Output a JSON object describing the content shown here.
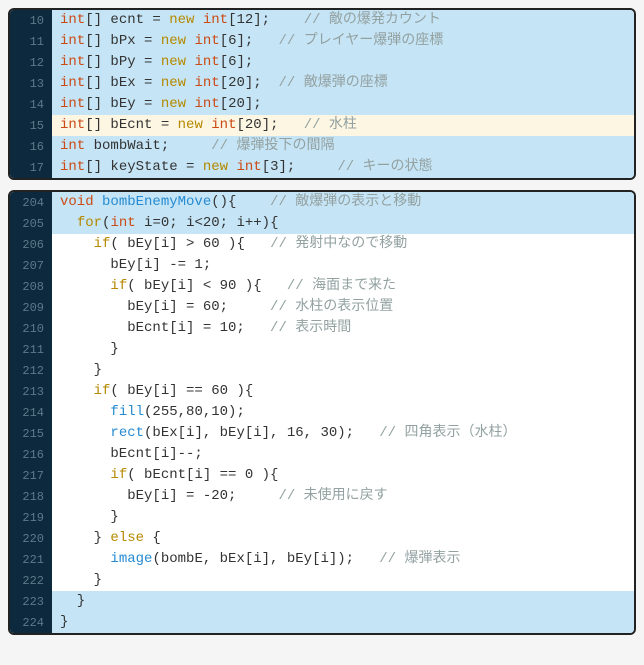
{
  "block1": {
    "lines": [
      {
        "num": "10",
        "hl": "hl-blue",
        "tokens": [
          {
            "t": "int",
            "c": "orange"
          },
          {
            "t": "[] ecnt = ",
            "c": "ident"
          },
          {
            "t": "new",
            "c": "brown"
          },
          {
            "t": " ",
            "c": "ident"
          },
          {
            "t": "int",
            "c": "orange"
          },
          {
            "t": "[12];    ",
            "c": "ident"
          },
          {
            "t": "// 敵の爆発カウント",
            "c": "cmt"
          }
        ]
      },
      {
        "num": "11",
        "hl": "hl-blue",
        "tokens": [
          {
            "t": "int",
            "c": "orange"
          },
          {
            "t": "[] bPx = ",
            "c": "ident"
          },
          {
            "t": "new",
            "c": "brown"
          },
          {
            "t": " ",
            "c": "ident"
          },
          {
            "t": "int",
            "c": "orange"
          },
          {
            "t": "[6];   ",
            "c": "ident"
          },
          {
            "t": "// プレイヤー爆弾の座標",
            "c": "cmt"
          }
        ]
      },
      {
        "num": "12",
        "hl": "hl-blue",
        "tokens": [
          {
            "t": "int",
            "c": "orange"
          },
          {
            "t": "[] bPy = ",
            "c": "ident"
          },
          {
            "t": "new",
            "c": "brown"
          },
          {
            "t": " ",
            "c": "ident"
          },
          {
            "t": "int",
            "c": "orange"
          },
          {
            "t": "[6];",
            "c": "ident"
          }
        ]
      },
      {
        "num": "13",
        "hl": "hl-blue",
        "tokens": [
          {
            "t": "int",
            "c": "orange"
          },
          {
            "t": "[] bEx = ",
            "c": "ident"
          },
          {
            "t": "new",
            "c": "brown"
          },
          {
            "t": " ",
            "c": "ident"
          },
          {
            "t": "int",
            "c": "orange"
          },
          {
            "t": "[20];  ",
            "c": "ident"
          },
          {
            "t": "// 敵爆弾の座標",
            "c": "cmt"
          }
        ]
      },
      {
        "num": "14",
        "hl": "hl-blue",
        "tokens": [
          {
            "t": "int",
            "c": "orange"
          },
          {
            "t": "[] bEy = ",
            "c": "ident"
          },
          {
            "t": "new",
            "c": "brown"
          },
          {
            "t": " ",
            "c": "ident"
          },
          {
            "t": "int",
            "c": "orange"
          },
          {
            "t": "[20];",
            "c": "ident"
          }
        ]
      },
      {
        "num": "15",
        "hl": "hl-beige",
        "tokens": [
          {
            "t": "int",
            "c": "orange"
          },
          {
            "t": "[] bEcnt = ",
            "c": "ident"
          },
          {
            "t": "new",
            "c": "brown"
          },
          {
            "t": " ",
            "c": "ident"
          },
          {
            "t": "int",
            "c": "orange"
          },
          {
            "t": "[20];   ",
            "c": "ident"
          },
          {
            "t": "// 水柱",
            "c": "cmt"
          }
        ]
      },
      {
        "num": "16",
        "hl": "hl-blue",
        "tokens": [
          {
            "t": "int",
            "c": "orange"
          },
          {
            "t": " bombWait;     ",
            "c": "ident"
          },
          {
            "t": "// 爆弾投下の間隔",
            "c": "cmt"
          }
        ]
      },
      {
        "num": "17",
        "hl": "hl-blue",
        "tokens": [
          {
            "t": "int",
            "c": "orange"
          },
          {
            "t": "[] keyState = ",
            "c": "ident"
          },
          {
            "t": "new",
            "c": "brown"
          },
          {
            "t": " ",
            "c": "ident"
          },
          {
            "t": "int",
            "c": "orange"
          },
          {
            "t": "[3];     ",
            "c": "ident"
          },
          {
            "t": "// キーの状態",
            "c": "cmt"
          }
        ]
      }
    ]
  },
  "block2": {
    "lines": [
      {
        "num": "204",
        "hl": "hl-blue",
        "tokens": [
          {
            "t": "void",
            "c": "orange"
          },
          {
            "t": " ",
            "c": "ident"
          },
          {
            "t": "bombEnemyMove",
            "c": "kw"
          },
          {
            "t": "(){    ",
            "c": "ident"
          },
          {
            "t": "// 敵爆弾の表示と移動",
            "c": "cmt"
          }
        ]
      },
      {
        "num": "205",
        "hl": "hl-blue",
        "tokens": [
          {
            "t": "  ",
            "c": "ident"
          },
          {
            "t": "for",
            "c": "brown"
          },
          {
            "t": "(",
            "c": "ident"
          },
          {
            "t": "int",
            "c": "orange"
          },
          {
            "t": " i=0; i<20; i++){",
            "c": "ident"
          }
        ]
      },
      {
        "num": "206",
        "hl": "hl-white",
        "tokens": [
          {
            "t": "    ",
            "c": "ident"
          },
          {
            "t": "if",
            "c": "brown"
          },
          {
            "t": "( bEy[i] > 60 ){   ",
            "c": "ident"
          },
          {
            "t": "// 発射中なので移動",
            "c": "cmt"
          }
        ]
      },
      {
        "num": "207",
        "hl": "hl-white",
        "tokens": [
          {
            "t": "      bEy[i] -= 1;",
            "c": "ident"
          }
        ]
      },
      {
        "num": "208",
        "hl": "hl-white",
        "tokens": [
          {
            "t": "      ",
            "c": "ident"
          },
          {
            "t": "if",
            "c": "brown"
          },
          {
            "t": "( bEy[i] < 90 ){   ",
            "c": "ident"
          },
          {
            "t": "// 海面まで来た",
            "c": "cmt"
          }
        ]
      },
      {
        "num": "209",
        "hl": "hl-white",
        "tokens": [
          {
            "t": "        bEy[i] = 60;     ",
            "c": "ident"
          },
          {
            "t": "// 水柱の表示位置",
            "c": "cmt"
          }
        ]
      },
      {
        "num": "210",
        "hl": "hl-white",
        "tokens": [
          {
            "t": "        bEcnt[i] = 10;   ",
            "c": "ident"
          },
          {
            "t": "// 表示時間",
            "c": "cmt"
          }
        ]
      },
      {
        "num": "211",
        "hl": "hl-white",
        "tokens": [
          {
            "t": "      }",
            "c": "ident"
          }
        ]
      },
      {
        "num": "212",
        "hl": "hl-white",
        "tokens": [
          {
            "t": "    }",
            "c": "ident"
          }
        ]
      },
      {
        "num": "213",
        "hl": "hl-white",
        "tokens": [
          {
            "t": "    ",
            "c": "ident"
          },
          {
            "t": "if",
            "c": "brown"
          },
          {
            "t": "( bEy[i] == 60 ){",
            "c": "ident"
          }
        ]
      },
      {
        "num": "214",
        "hl": "hl-white",
        "tokens": [
          {
            "t": "      ",
            "c": "ident"
          },
          {
            "t": "fill",
            "c": "kw"
          },
          {
            "t": "(255,80,10);",
            "c": "ident"
          }
        ]
      },
      {
        "num": "215",
        "hl": "hl-white",
        "tokens": [
          {
            "t": "      ",
            "c": "ident"
          },
          {
            "t": "rect",
            "c": "kw"
          },
          {
            "t": "(bEx[i], bEy[i], 16, 30);   ",
            "c": "ident"
          },
          {
            "t": "// 四角表示（水柱）",
            "c": "cmt"
          }
        ]
      },
      {
        "num": "216",
        "hl": "hl-white",
        "tokens": [
          {
            "t": "      bEcnt[i]--;",
            "c": "ident"
          }
        ]
      },
      {
        "num": "217",
        "hl": "hl-white",
        "tokens": [
          {
            "t": "      ",
            "c": "ident"
          },
          {
            "t": "if",
            "c": "brown"
          },
          {
            "t": "( bEcnt[i] == 0 ){",
            "c": "ident"
          }
        ]
      },
      {
        "num": "218",
        "hl": "hl-white",
        "tokens": [
          {
            "t": "        bEy[i] = -20;     ",
            "c": "ident"
          },
          {
            "t": "// 未使用に戻す",
            "c": "cmt"
          }
        ]
      },
      {
        "num": "219",
        "hl": "hl-white",
        "tokens": [
          {
            "t": "      }",
            "c": "ident"
          }
        ]
      },
      {
        "num": "220",
        "hl": "hl-white",
        "tokens": [
          {
            "t": "    } ",
            "c": "ident"
          },
          {
            "t": "else",
            "c": "brown"
          },
          {
            "t": " {",
            "c": "ident"
          }
        ]
      },
      {
        "num": "221",
        "hl": "hl-white",
        "tokens": [
          {
            "t": "      ",
            "c": "ident"
          },
          {
            "t": "image",
            "c": "kw"
          },
          {
            "t": "(bombE, bEx[i], bEy[i]);   ",
            "c": "ident"
          },
          {
            "t": "// 爆弾表示",
            "c": "cmt"
          }
        ]
      },
      {
        "num": "222",
        "hl": "hl-white",
        "tokens": [
          {
            "t": "    }",
            "c": "ident"
          }
        ]
      },
      {
        "num": "223",
        "hl": "hl-blue",
        "tokens": [
          {
            "t": "  }",
            "c": "ident"
          }
        ]
      },
      {
        "num": "224",
        "hl": "hl-blue",
        "tokens": [
          {
            "t": "}",
            "c": "ident"
          }
        ]
      }
    ]
  }
}
